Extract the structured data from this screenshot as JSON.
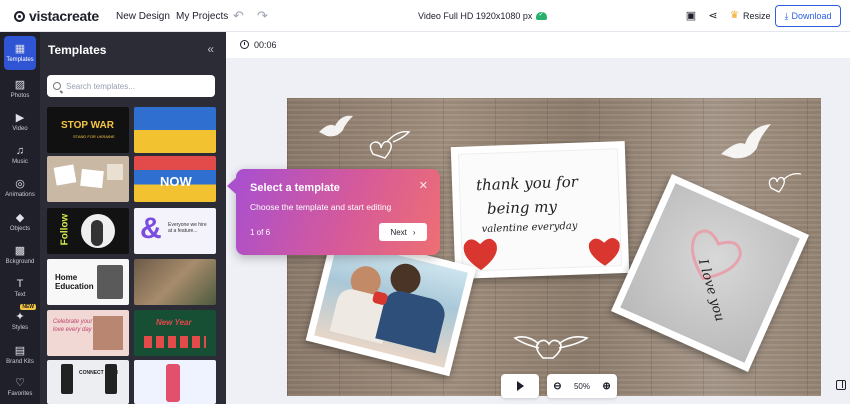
{
  "app": {
    "logo_text": "vistacreate"
  },
  "header": {
    "new_design": "New Design",
    "my_projects": "My Projects",
    "doc_title": "Video Full HD 1920x1080 px",
    "resize": "Resize",
    "download": "Download"
  },
  "rail": [
    {
      "label": "Templates",
      "icon": "grid-icon",
      "active": true
    },
    {
      "label": "Photos",
      "icon": "image-icon"
    },
    {
      "label": "Video",
      "icon": "video-icon"
    },
    {
      "label": "Music",
      "icon": "music-icon"
    },
    {
      "label": "Animations",
      "icon": "animation-icon"
    },
    {
      "label": "Objects",
      "icon": "shapes-icon"
    },
    {
      "label": "Bckground",
      "icon": "background-icon"
    },
    {
      "label": "Text",
      "icon": "text-icon"
    },
    {
      "label": "Styles",
      "icon": "styles-icon",
      "badge": "NEW"
    },
    {
      "label": "Brand Kits",
      "icon": "brand-kit-icon"
    },
    {
      "label": "Favorites",
      "icon": "heart-icon"
    }
  ],
  "panel": {
    "title": "Templates",
    "search_placeholder": "Search templates...",
    "thumbs": [
      {
        "text": "STOP WAR",
        "sub": "STAND FOR UKRAINE"
      },
      {
        "text": "",
        "sub": ""
      },
      {
        "text": "",
        "sub": ""
      },
      {
        "text": "NOW",
        "sub": ""
      },
      {
        "text": "Follow",
        "sub": ""
      },
      {
        "text": "&",
        "sub": "Everyone we hire at a feature..."
      },
      {
        "text": "Home Education",
        "sub": ""
      },
      {
        "text": "",
        "sub": ""
      },
      {
        "text": "Celebrate your love every day",
        "sub": ""
      },
      {
        "text": "New Year",
        "sub": ""
      },
      {
        "text": "CONNECT WITH",
        "sub": ""
      },
      {
        "text": "",
        "sub": ""
      }
    ]
  },
  "timeline": {
    "time": "00:06"
  },
  "canvas": {
    "card_text_lines": [
      "thank you for",
      "being my",
      "valentine everyday"
    ],
    "photo_card_text": "I love you"
  },
  "tooltip": {
    "title": "Select a template",
    "subtitle": "Choose the template and start editing",
    "step": "1 of 6",
    "next": "Next"
  },
  "controls": {
    "zoom": "50%"
  },
  "colors": {
    "accent": "#2f55d4",
    "tooltip_start": "#a84fd0",
    "tooltip_end": "#ee6f73"
  }
}
